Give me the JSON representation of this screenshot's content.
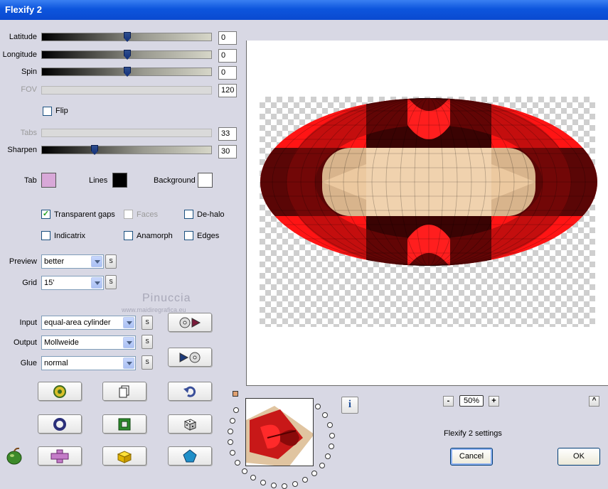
{
  "window": {
    "title": "Flexify 2"
  },
  "sliders": [
    {
      "label": "Latitude",
      "value": "0",
      "pos": 0.5,
      "enabled": true
    },
    {
      "label": "Longitude",
      "value": "0",
      "pos": 0.5,
      "enabled": true
    },
    {
      "label": "Spin",
      "value": "0",
      "pos": 0.5,
      "enabled": true
    },
    {
      "label": "FOV",
      "value": "120",
      "enabled": false
    },
    {
      "label": "Tabs",
      "value": "33",
      "enabled": false
    },
    {
      "label": "Sharpen",
      "value": "30",
      "pos": 0.3,
      "enabled": true
    }
  ],
  "flip": {
    "label": "Flip",
    "checked": false
  },
  "colors": {
    "tab_label": "Tab",
    "tab_color": "#d8a8d8",
    "lines_label": "Lines",
    "lines_color": "#000000",
    "background_label": "Background",
    "background_color": "#ffffff"
  },
  "options": {
    "transparent_gaps": {
      "label": "Transparent gaps",
      "checked": true
    },
    "faces": {
      "label": "Faces",
      "checked": false
    },
    "dehalo": {
      "label": "De-halo",
      "checked": false
    },
    "indicatrix": {
      "label": "Indicatrix",
      "checked": false
    },
    "anamorph": {
      "label": "Anamorph",
      "checked": false
    },
    "edges": {
      "label": "Edges",
      "checked": false
    }
  },
  "preview": {
    "label": "Preview",
    "value": "better"
  },
  "grid": {
    "label": "Grid",
    "value": "15'"
  },
  "input": {
    "label": "Input",
    "value": "equal-area cylinder"
  },
  "output": {
    "label": "Output",
    "value": "Mollweide"
  },
  "glue": {
    "label": "Glue",
    "value": "normal"
  },
  "s_button": "S",
  "watermark": {
    "line1": "Pinuccia",
    "line2": "www.maidiregrafica.eu"
  },
  "zoom": {
    "value": "50%",
    "minus": "-",
    "plus": "+"
  },
  "settings_title": "Flexify 2 settings",
  "scroll_up": "^",
  "buttons": {
    "cancel": "Cancel",
    "ok": "OK",
    "info": "i"
  }
}
